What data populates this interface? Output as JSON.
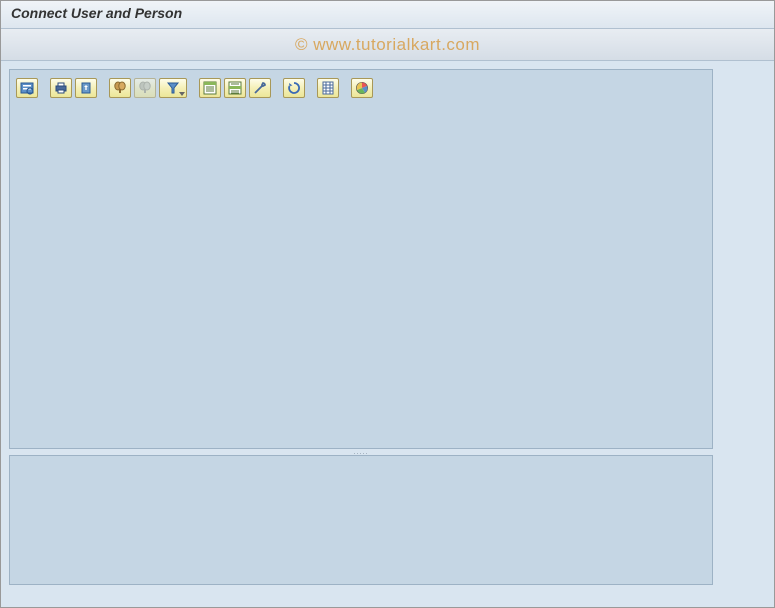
{
  "header": {
    "title": "Connect User and Person"
  },
  "watermark": "© www.tutorialkart.com",
  "toolbar": {
    "buttons": [
      {
        "name": "details-icon"
      },
      {
        "name": "print-icon"
      },
      {
        "name": "export-icon"
      },
      {
        "name": "find-icon"
      },
      {
        "name": "find-next-icon"
      },
      {
        "name": "filter-icon"
      },
      {
        "name": "sum-icon"
      },
      {
        "name": "subtotal-icon"
      },
      {
        "name": "layout-icon"
      },
      {
        "name": "refresh-icon"
      },
      {
        "name": "excel-icon"
      },
      {
        "name": "graphic-icon"
      }
    ]
  },
  "splitter": {
    "dots": "....."
  }
}
